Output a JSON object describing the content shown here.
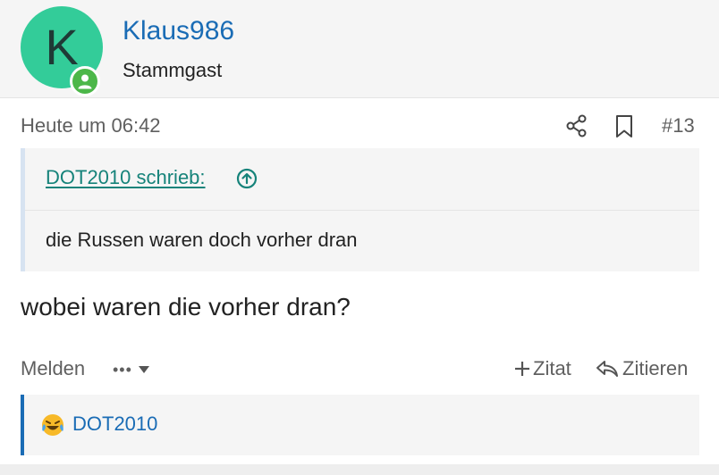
{
  "user": {
    "avatar_letter": "K",
    "name": "Klaus986",
    "title": "Stammgast",
    "avatar_color": "#33cc99",
    "online_color": "#4cb749"
  },
  "post": {
    "timestamp": "Heute um 06:42",
    "number": "#13",
    "body": "wobei waren die vorher dran?",
    "quote": {
      "author_link": "DOT2010 schrieb:",
      "text": "die Russen waren doch vorher dran"
    }
  },
  "actions": {
    "report": "Melden",
    "more": "•••",
    "zitat": "Zitat",
    "zitieren": "Zitieren"
  },
  "reactions": {
    "emoji": "laughing-tears",
    "user": "DOT2010"
  },
  "colors": {
    "link_blue": "#1a6cb5",
    "quote_link_teal": "#16837a",
    "muted": "#5f5f5f"
  }
}
